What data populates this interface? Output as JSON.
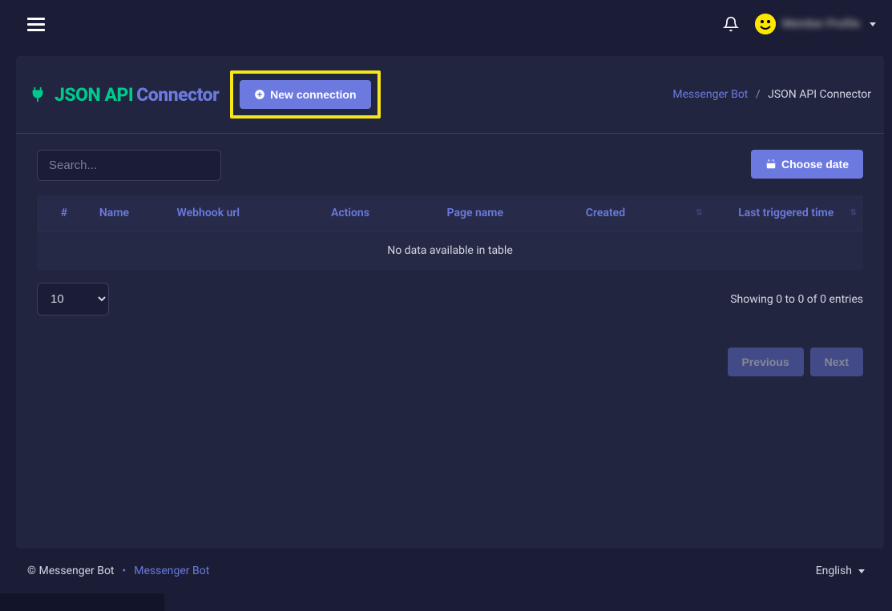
{
  "header": {
    "user_name": "Member Profile"
  },
  "page": {
    "title_left": "JSON API",
    "title_right": "Connector",
    "new_connection_label": "New connection",
    "breadcrumb_parent": "Messenger Bot",
    "breadcrumb_current": "JSON API Connector"
  },
  "controls": {
    "search_placeholder": "Search...",
    "choose_date_label": "Choose date",
    "per_page_selected": "10",
    "showing_text": "Showing 0 to 0 of 0 entries"
  },
  "table": {
    "columns": {
      "num": "#",
      "name": "Name",
      "webhook": "Webhook url",
      "actions": "Actions",
      "page_name": "Page name",
      "created": "Created",
      "last_triggered": "Last triggered time"
    },
    "empty_text": "No data available in table",
    "rows": []
  },
  "pager": {
    "previous": "Previous",
    "next": "Next"
  },
  "footer": {
    "copyright": "© Messenger Bot",
    "link_text": "Messenger Bot",
    "language": "English"
  }
}
